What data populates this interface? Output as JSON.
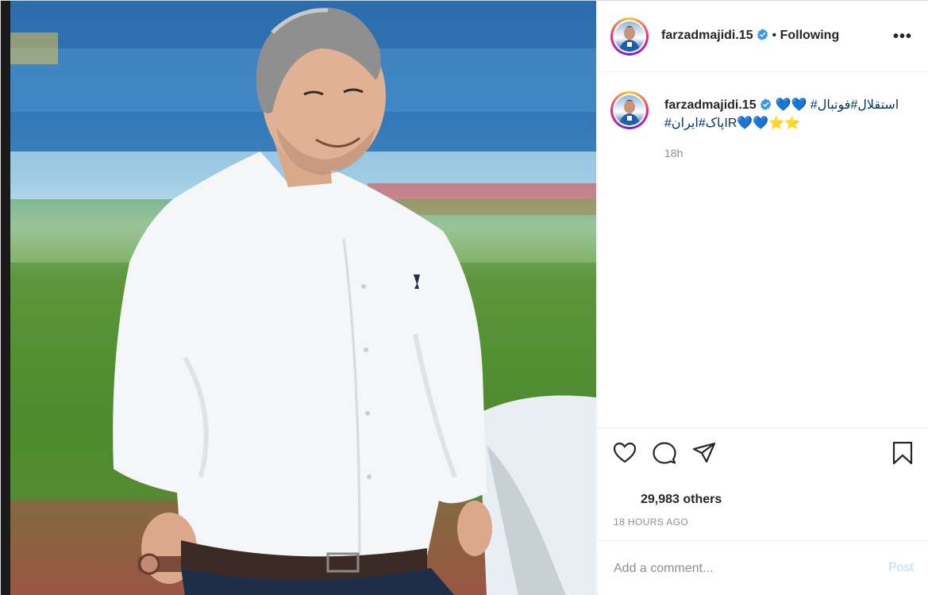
{
  "post": {
    "photo_alt": "",
    "author": {
      "username": "farzadmajidi.15",
      "verified": true,
      "follow_status": "Following",
      "separator": "•"
    },
    "more_icon": "more-horizontal-icon",
    "caption": {
      "username": "farzadmajidi.15",
      "text": "استقلال#فوتبال# 💙💙⭐⭐💙💙IRپاک#ایران#",
      "time": "18h"
    },
    "actions": {
      "like_icon": "heart-icon",
      "comment_icon": "comment-icon",
      "share_icon": "share-icon",
      "save_icon": "bookmark-icon"
    },
    "likes_text": "29,983 others",
    "timestamp": "18 HOURS AGO",
    "comment": {
      "placeholder": "Add a comment...",
      "post_label": "Post"
    },
    "colors": {
      "verified_blue": "#3897f0",
      "post_button_disabled": "#b2dffc",
      "secondary_text": "#8e8e8e"
    }
  }
}
